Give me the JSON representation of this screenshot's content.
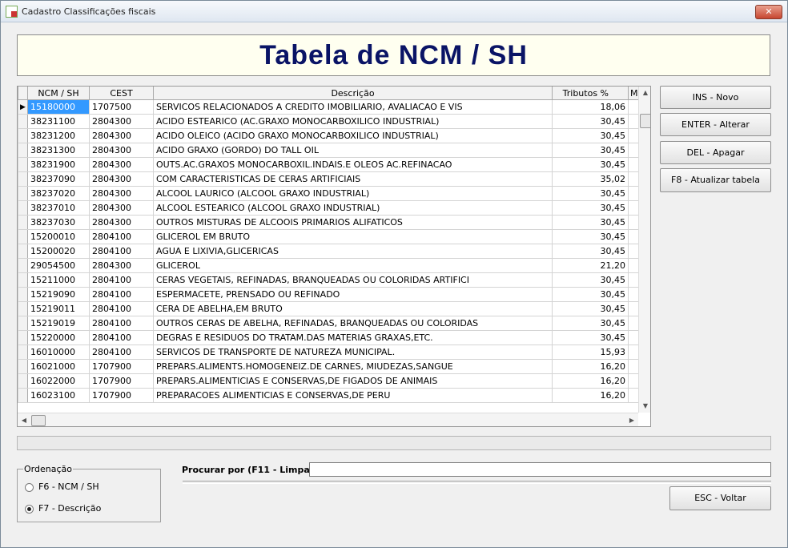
{
  "window": {
    "title": "Cadastro Classificações fiscais",
    "close_label": "✕"
  },
  "banner": {
    "heading": "Tabela de NCM / SH"
  },
  "grid": {
    "columns": [
      "NCM / SH",
      "CEST",
      "Descrição",
      "Tributos %",
      "M"
    ],
    "rows": [
      {
        "ncm": "15180000",
        "cest": "1707500",
        "desc": "SERVICOS RELACIONADOS A CREDITO IMOBILIARIO, AVALIACAO E VIS",
        "trib": "18,06"
      },
      {
        "ncm": "38231100",
        "cest": "2804300",
        "desc": "ACIDO ESTEARICO (AC.GRAXO MONOCARBOXILICO INDUSTRIAL)",
        "trib": "30,45"
      },
      {
        "ncm": "38231200",
        "cest": "2804300",
        "desc": "ACIDO OLEICO (ACIDO GRAXO MONOCARBOXILICO INDUSTRIAL)",
        "trib": "30,45"
      },
      {
        "ncm": "38231300",
        "cest": "2804300",
        "desc": "ACIDO GRAXO (GORDO) DO TALL OIL",
        "trib": "30,45"
      },
      {
        "ncm": "38231900",
        "cest": "2804300",
        "desc": "OUTS.AC.GRAXOS MONOCARBOXIL.INDAIS.E OLEOS AC.REFINACAO",
        "trib": "30,45"
      },
      {
        "ncm": "38237090",
        "cest": "2804300",
        "desc": "COM CARACTERISTICAS DE CERAS ARTIFICIAIS",
        "trib": "35,02"
      },
      {
        "ncm": "38237020",
        "cest": "2804300",
        "desc": "ALCOOL LAURICO (ALCOOL GRAXO INDUSTRIAL)",
        "trib": "30,45"
      },
      {
        "ncm": "38237010",
        "cest": "2804300",
        "desc": "ALCOOL ESTEARICO (ALCOOL GRAXO INDUSTRIAL)",
        "trib": "30,45"
      },
      {
        "ncm": "38237030",
        "cest": "2804300",
        "desc": "OUTROS MISTURAS DE ALCOOIS PRIMARIOS ALIFATICOS",
        "trib": "30,45"
      },
      {
        "ncm": "15200010",
        "cest": "2804100",
        "desc": "GLICEROL EM BRUTO",
        "trib": "30,45"
      },
      {
        "ncm": "15200020",
        "cest": "2804100",
        "desc": "AGUA E LIXIVIA,GLICERICAS",
        "trib": "30,45"
      },
      {
        "ncm": "29054500",
        "cest": "2804300",
        "desc": "GLICEROL",
        "trib": "21,20"
      },
      {
        "ncm": "15211000",
        "cest": "2804100",
        "desc": "CERAS VEGETAIS, REFINADAS, BRANQUEADAS OU COLORIDAS ARTIFICI",
        "trib": "30,45"
      },
      {
        "ncm": "15219090",
        "cest": "2804100",
        "desc": "ESPERMACETE, PRENSADO OU REFINADO",
        "trib": "30,45"
      },
      {
        "ncm": "15219011",
        "cest": "2804100",
        "desc": "CERA DE ABELHA,EM BRUTO",
        "trib": "30,45"
      },
      {
        "ncm": "15219019",
        "cest": "2804100",
        "desc": "OUTROS CERAS DE ABELHA, REFINADAS, BRANQUEADAS OU COLORIDAS",
        "trib": "30,45"
      },
      {
        "ncm": "15220000",
        "cest": "2804100",
        "desc": "DEGRAS E RESIDUOS DO TRATAM.DAS MATERIAS GRAXAS,ETC.",
        "trib": "30,45"
      },
      {
        "ncm": "16010000",
        "cest": "2804100",
        "desc": "SERVICOS DE TRANSPORTE DE NATUREZA MUNICIPAL.",
        "trib": "15,93"
      },
      {
        "ncm": "16021000",
        "cest": "1707900",
        "desc": "PREPARS.ALIMENTS.HOMOGENEIZ.DE CARNES, MIUDEZAS,SANGUE",
        "trib": "16,20"
      },
      {
        "ncm": "16022000",
        "cest": "1707900",
        "desc": "PREPARS.ALIMENTICIAS E CONSERVAS,DE FIGADOS DE ANIMAIS",
        "trib": "16,20"
      },
      {
        "ncm": "16023100",
        "cest": "1707900",
        "desc": "PREPARACOES ALIMENTICIAS E CONSERVAS,DE PERU",
        "trib": "16,20"
      }
    ]
  },
  "actions": {
    "new_label": "INS - Novo",
    "edit_label": "ENTER - Alterar",
    "delete_label": "DEL - Apagar",
    "refresh_label": "F8 - Atualizar tabela",
    "back_label": "ESC - Voltar"
  },
  "sort": {
    "legend": "Ordenação",
    "options": [
      {
        "label": "F6 - NCM / SH",
        "checked": false
      },
      {
        "label": "F7 - Descrição",
        "checked": true
      }
    ]
  },
  "search": {
    "label": "Procurar por (F11 - Limpar )",
    "value": ""
  }
}
